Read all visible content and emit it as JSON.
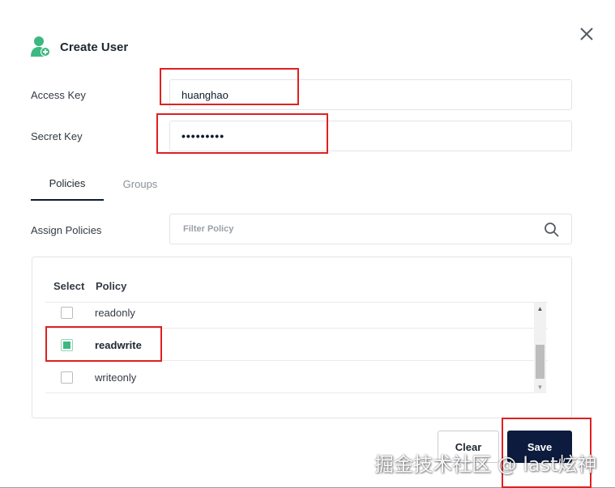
{
  "dialog": {
    "title": "Create User",
    "title_icon": "user-add-icon",
    "close_icon": "close-icon"
  },
  "form": {
    "access_key": {
      "label": "Access Key",
      "value": "huanghao"
    },
    "secret_key": {
      "label": "Secret Key",
      "value": "•••••••••"
    }
  },
  "tabs": [
    {
      "label": "Policies",
      "active": true
    },
    {
      "label": "Groups",
      "active": false
    }
  ],
  "policies": {
    "assign_label": "Assign Policies",
    "filter_placeholder": "Filter Policy",
    "search_icon": "search-icon",
    "columns": {
      "select": "Select",
      "policy": "Policy"
    },
    "rows": [
      {
        "name": "readonly",
        "checked": false
      },
      {
        "name": "readwrite",
        "checked": true
      },
      {
        "name": "writeonly",
        "checked": false
      }
    ]
  },
  "actions": {
    "clear_label": "Clear",
    "save_label": "Save"
  },
  "watermark": "掘金技术社区 @ last炫神",
  "colors": {
    "primary": "#0d1b3e",
    "checked": "#3cb881",
    "annotation": "#e02020"
  }
}
